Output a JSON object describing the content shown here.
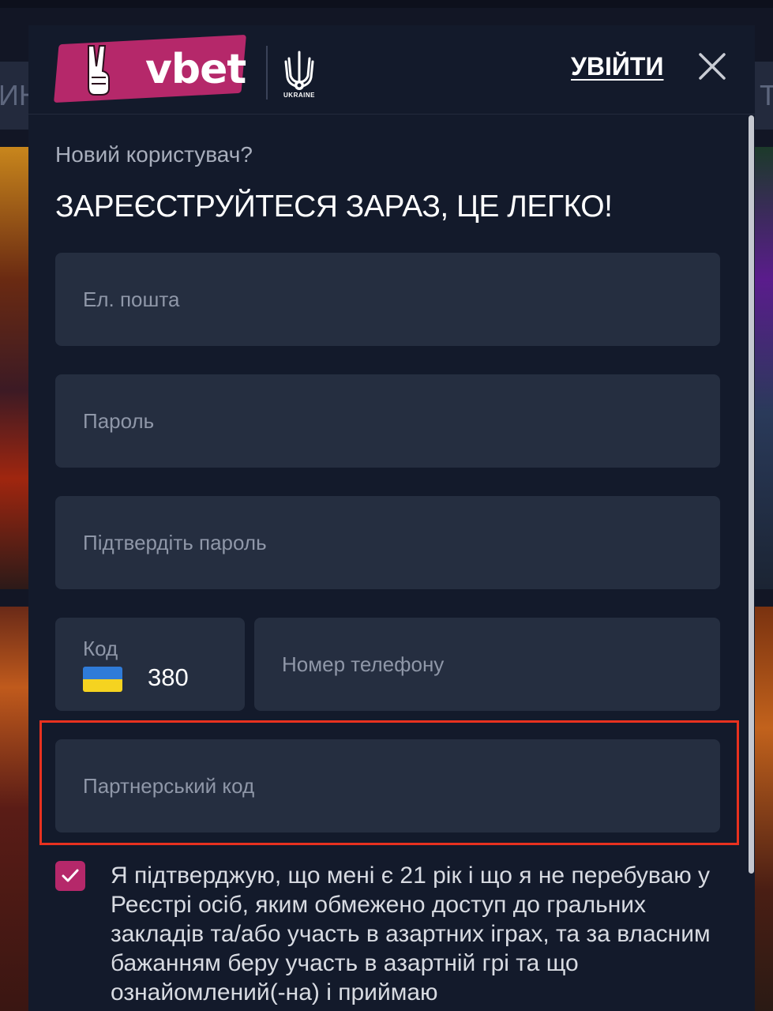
{
  "background": {
    "nav_left_fragment": "ИНС",
    "nav_right_fragment": "Т"
  },
  "header": {
    "logo_text": "vbet",
    "partner_caption": "UKRAINE",
    "login_label": "УВІЙТИ",
    "close_icon": "close-icon"
  },
  "form": {
    "subtitle": "Новий користувач?",
    "title": "ЗАРЕЄСТРУЙТЕСЯ ЗАРАЗ, ЦЕ ЛЕГКО!",
    "email_placeholder": "Ел. пошта",
    "password_placeholder": "Пароль",
    "confirm_password_placeholder": "Підтвердіть пароль",
    "phone_code_label": "Код",
    "phone_code_value": "380",
    "phone_country_flag": "ukraine-flag-icon",
    "phone_placeholder": "Номер телефону",
    "partner_code_placeholder": "Партнерський код",
    "consent_checked": true,
    "consent_text": "Я підтверджую, що мені є 21 рік і що я не перебуваю у Реєстрі осіб, яким обмежено доступ до гральних закладів та/або участь в азартних іграх, та за власним бажанням беру участь в азартній грі та що ознайомлений(-на) і приймаю"
  },
  "colors": {
    "accent": "#b5286a",
    "modal_bg": "#131a2b",
    "field_bg": "#252e40",
    "highlight": "#e8311f"
  }
}
